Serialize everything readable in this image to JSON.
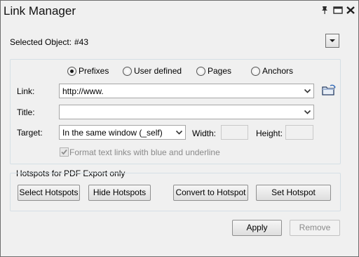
{
  "window": {
    "title": "Link Manager"
  },
  "selected_object": {
    "label": "Selected Object:",
    "value": "#43"
  },
  "link_types": [
    {
      "label": "Prefixes",
      "selected": true
    },
    {
      "label": "User defined",
      "selected": false
    },
    {
      "label": "Pages",
      "selected": false
    },
    {
      "label": "Anchors",
      "selected": false
    }
  ],
  "form": {
    "link_label": "Link:",
    "link_value": "http://www.",
    "title_label": "Title:",
    "title_value": "",
    "target_label": "Target:",
    "target_value": "In the same window (_self)",
    "width_label": "Width:",
    "width_value": "",
    "height_label": "Height:",
    "height_value": "",
    "format_checkbox_label": "Format text links with blue and underline",
    "format_checkbox_checked": true
  },
  "hotspots": {
    "group_label": "Hotspots for PDF Export only",
    "select_label": "Select Hotspots",
    "hide_label": "Hide Hotspots",
    "convert_label": "Convert to Hotspot",
    "set_label": "Set Hotspot"
  },
  "actions": {
    "apply_label": "Apply",
    "remove_label": "Remove"
  },
  "icons": {
    "titlebar": [
      "pin-icon",
      "restore-icon",
      "close-icon"
    ],
    "browse": "open-folder-icon"
  },
  "colors": {
    "window_bg": "#f0f0f0",
    "groupbox_border": "#d5dfe5",
    "disabled_text": "#8a8a8a"
  }
}
